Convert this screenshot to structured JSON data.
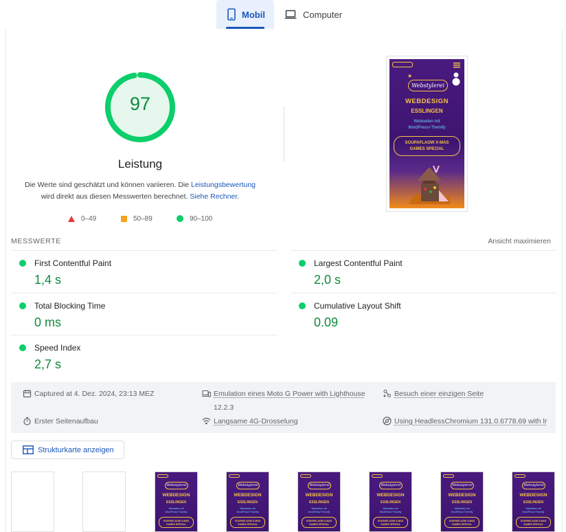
{
  "tabs": {
    "mobile": "Mobil",
    "desktop": "Computer"
  },
  "performance": {
    "score": "97",
    "title": "Leistung",
    "desc_part1": "Die Werte sind geschätzt und können variieren. Die ",
    "desc_link1": "Leistungsbewertung",
    "desc_part2": "wird direkt aus diesen Messwerten berechnet. ",
    "desc_link2": "Siehe Rechner",
    "desc_part3": ".",
    "gauge_fraction": 0.97,
    "color_pass": "#0cce6b"
  },
  "legend": {
    "fail": "0–49",
    "average": "50–89",
    "pass": "90–100"
  },
  "preview": {
    "logo": "Webstylerei",
    "heading": "WEBDESIGN",
    "city": "ESSLINGEN",
    "sub1": "Webseiten mit",
    "sub2": "WordPress+Themify",
    "cta1": "SOUPAFLAOW X-MAS",
    "cta2": "GAMES SPECIAL"
  },
  "metrics_section": {
    "label": "MESSWERTE",
    "expand": "Ansicht maximieren"
  },
  "metrics": [
    {
      "label": "First Contentful Paint",
      "value": "1,4 s"
    },
    {
      "label": "Largest Contentful Paint",
      "value": "2,0 s"
    },
    {
      "label": "Total Blocking Time",
      "value": "0 ms"
    },
    {
      "label": "Cumulative Layout Shift",
      "value": "0.09"
    },
    {
      "label": "Speed Index",
      "value": "2,7 s"
    }
  ],
  "info": {
    "captured": "Captured at 4. Dez. 2024, 23:13 MEZ",
    "emulation": "Emulation eines Moto G Power with Lighthouse",
    "emulation_version": "12.2.3",
    "visit": "Besuch einer einzigen Seite",
    "first_load": "Erster Seitenaufbau",
    "throttling": "Langsame 4G-Drosselung",
    "browser": "Using HeadlessChromium 131.0.6778.69 with lr"
  },
  "treemap_button": "Strukturkarte anzeigen",
  "filmstrip": {
    "logo": "Webstylerei",
    "heading": "WEBDESIGN",
    "city": "ESSLINGEN",
    "sub1": "Webseiten mit",
    "sub2": "WordPress+Themify",
    "cta1": "SOUPAFLAOW X-MAS",
    "cta2": "GAMES SPECIAL"
  }
}
